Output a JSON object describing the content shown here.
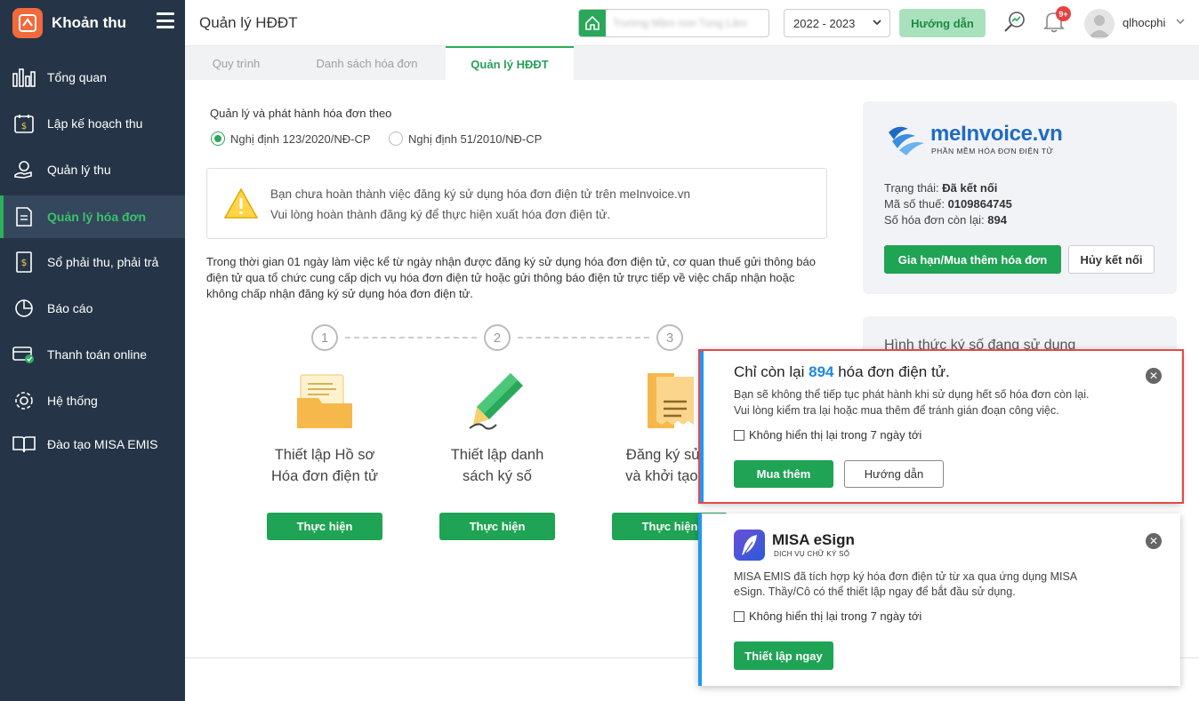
{
  "sidebar": {
    "app_title": "Khoản thu",
    "items": [
      {
        "label": "Tổng quan",
        "icon": "bar-chart-icon"
      },
      {
        "label": "Lập kế hoạch thu",
        "icon": "calendar-money-icon"
      },
      {
        "label": "Quản lý thu",
        "icon": "money-hand-icon"
      },
      {
        "label": "Quản lý hóa đơn",
        "icon": "invoice-icon",
        "active": true
      },
      {
        "label": "Sổ phải thu, phải trả",
        "icon": "ledger-icon"
      },
      {
        "label": "Báo cáo",
        "icon": "pie-chart-icon"
      },
      {
        "label": "Thanh toán online",
        "icon": "online-payment-icon"
      },
      {
        "label": "Hệ thống",
        "icon": "gear-icon"
      },
      {
        "label": "Đào tạo MISA EMIS",
        "icon": "book-icon"
      }
    ]
  },
  "header": {
    "page_title": "Quản lý HĐĐT",
    "school_name": "Trường Mầm non Tùng Lâm",
    "year": "2022 - 2023",
    "guide_label": "Hướng dẫn",
    "notification_badge": "9+",
    "username": "qlhocphi"
  },
  "tabs": [
    {
      "label": "Quy trình"
    },
    {
      "label": "Danh sách hóa đơn"
    },
    {
      "label": "Quản lý HĐĐT",
      "active": true
    }
  ],
  "main": {
    "intro_label": "Quản lý và phát hành hóa đơn theo",
    "radios": [
      {
        "label": "Nghị định 123/2020/NĐ-CP",
        "selected": true
      },
      {
        "label": "Nghị định 51/2010/NĐ-CP",
        "selected": false
      }
    ],
    "warning": {
      "line1": "Bạn chưa hoàn thành việc đăng ký sử dụng hóa đơn điện tử trên meInvoice.vn",
      "line2": "Vui lòng hoàn thành đăng ký để thực hiện xuất hóa đơn điện tử."
    },
    "paragraph": "Trong thời gian 01 ngày làm việc kể từ ngày nhận được đăng ký sử dụng hóa đơn điện tử, cơ quan thuế gửi thông báo điện tử qua tổ chức cung cấp dịch vụ hóa đơn điện tử hoặc gửi thông báo điện tử trực tiếp về việc chấp nhận hoặc không chấp nhận đăng ký sử dụng hóa đơn điện tử.",
    "steps": [
      {
        "num": "1",
        "line1": "Thiết lập Hồ sơ",
        "line2": "Hóa đơn điện tử",
        "button": "Thực hiện"
      },
      {
        "num": "2",
        "line1": "Thiết lập danh",
        "line2": "sách ký số",
        "button": "Thực hiện"
      },
      {
        "num": "3",
        "line1": "Đăng ký sử d",
        "line2": "và khởi tạo m",
        "button": "Thực hiện"
      }
    ]
  },
  "meinvoice": {
    "brand": "meInvoice.vn",
    "tagline": "PHẦN MỀM HÓA ĐƠN ĐIỆN TỬ",
    "status_label": "Trạng thái:",
    "status_value": "Đã kết nối",
    "tax_label": "Mã số thuế:",
    "tax_value": "0109864745",
    "remaining_label": "Số hóa đơn còn lại:",
    "remaining_value": "894",
    "renew_label": "Gia hạn/Mua thêm hóa đơn",
    "disconnect_label": "Hủy kết nối"
  },
  "sign_card": {
    "title": "Hình thức ký số đang sử dụng"
  },
  "popup_remaining": {
    "title_prefix": "Chỉ còn lại",
    "count": "894",
    "title_suffix": "hóa đơn điện tử.",
    "line1": "Bạn sẽ không thể tiếp tục phát hành khi sử dụng hết số hóa đơn còn lại.",
    "line2": "Vui lòng kiểm tra lại hoặc mua thêm để tránh gián đoạn công việc.",
    "checkbox_label": "Không hiển thị lại trong 7 ngày tới",
    "buy_label": "Mua thêm",
    "guide_label": "Hướng dẫn"
  },
  "popup_esign": {
    "brand": "MISA eSign",
    "tagline": "DỊCH VỤ CHỮ KÝ SỐ",
    "line1": "MISA EMIS đã tích hợp ký hóa đơn điện tử từ xa qua ứng dụng MISA",
    "line2": "eSign. Thầy/Cô có thể thiết lập ngay để bắt đầu sử dụng.",
    "checkbox_label": "Không hiển thị lại trong 7 ngày tới",
    "setup_label": "Thiết lập ngay"
  },
  "colors": {
    "sidebar_bg": "#253547",
    "accent_green": "#1fa354",
    "popup_border": "#e34a4a",
    "link_blue": "#1e88e5"
  }
}
